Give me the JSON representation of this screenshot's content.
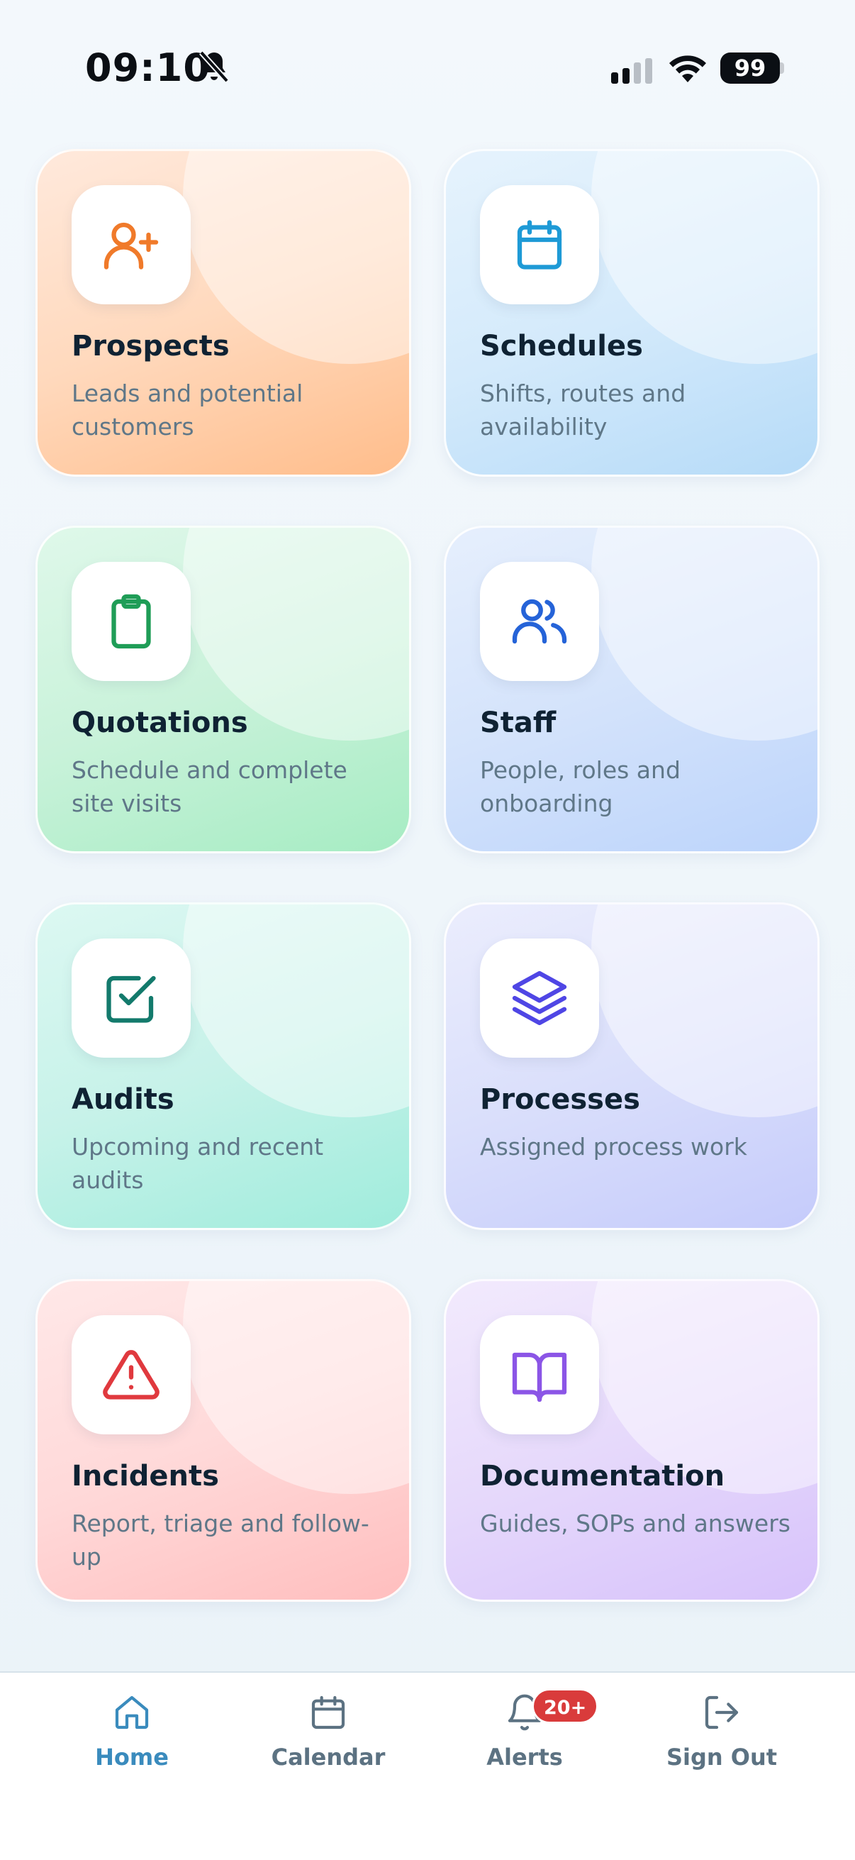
{
  "status_bar": {
    "time": "09:10",
    "battery": "99",
    "icons": [
      "bell-off-icon",
      "signal-icon",
      "wifi-icon",
      "battery-icon"
    ]
  },
  "tiles": [
    {
      "title": "Prospects",
      "subtitle": "Leads and potential customers",
      "icon": "user-plus-icon",
      "accent": "#f07a2a"
    },
    {
      "title": "Schedules",
      "subtitle": "Shifts, routes and availability",
      "icon": "calendar-icon",
      "accent": "#1e9ad6"
    },
    {
      "title": "Quotations",
      "subtitle": "Schedule and complete site visits",
      "icon": "clipboard-icon",
      "accent": "#1f9d57"
    },
    {
      "title": "Staff",
      "subtitle": "People, roles and onboarding",
      "icon": "users-icon",
      "accent": "#2563d8"
    },
    {
      "title": "Audits",
      "subtitle": "Upcoming and recent audits",
      "icon": "check-square-icon",
      "accent": "#137a6c"
    },
    {
      "title": "Processes",
      "subtitle": "Assigned process work",
      "icon": "layers-icon",
      "accent": "#4f46e5"
    },
    {
      "title": "Incidents",
      "subtitle": "Report, triage and follow-up",
      "icon": "alert-triangle-icon",
      "accent": "#e0393e"
    },
    {
      "title": "Documentation",
      "subtitle": "Guides, SOPs and answers",
      "icon": "book-open-icon",
      "accent": "#8b55e6"
    }
  ],
  "tab_bar": {
    "tabs": [
      {
        "label": "Home",
        "icon": "home-icon",
        "active": true
      },
      {
        "label": "Calendar",
        "icon": "calendar-icon",
        "active": false
      },
      {
        "label": "Alerts",
        "icon": "bell-icon",
        "active": false,
        "badge": "20+"
      },
      {
        "label": "Sign Out",
        "icon": "log-out-icon",
        "active": false
      }
    ],
    "active_color": "#3a8bbd",
    "inactive_color": "#5c7282",
    "badge_color": "#d93b3b"
  }
}
